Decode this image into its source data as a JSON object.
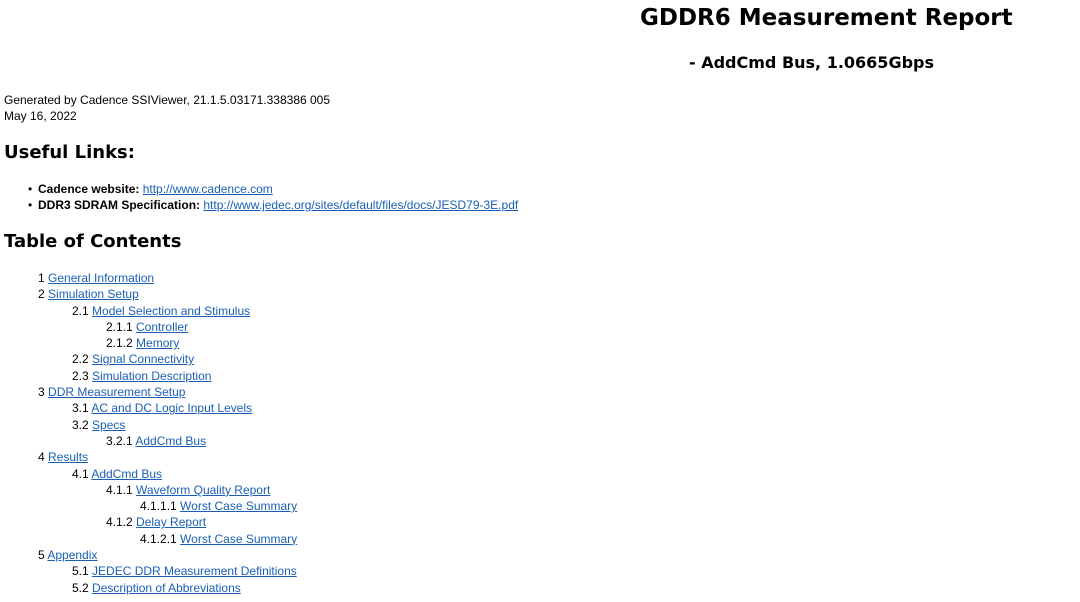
{
  "header": {
    "title": "GDDR6 Measurement Report",
    "subtitle": "- AddCmd Bus, 1.0665Gbps"
  },
  "meta": {
    "generated_by": "Generated by Cadence SSIViewer, 21.1.5.03171.338386 005",
    "date": "May 16, 2022"
  },
  "useful_links": {
    "heading": "Useful Links:",
    "items": [
      {
        "label": "Cadence website:",
        "url_text": "http://www.cadence.com"
      },
      {
        "label": "DDR3 SDRAM Specification:",
        "url_text": "http://www.jedec.org/sites/default/files/docs/JESD79-3E.pdf"
      }
    ]
  },
  "toc": {
    "heading": "Table of Contents",
    "items": [
      {
        "num": "1",
        "text": "General Information",
        "level": 1
      },
      {
        "num": "2",
        "text": "Simulation Setup",
        "level": 1
      },
      {
        "num": "2.1",
        "text": "Model Selection and Stimulus",
        "level": 2
      },
      {
        "num": "2.1.1",
        "text": "Controller",
        "level": 3
      },
      {
        "num": "2.1.2",
        "text": "Memory",
        "level": 3
      },
      {
        "num": "2.2",
        "text": "Signal Connectivity",
        "level": 2
      },
      {
        "num": "2.3",
        "text": "Simulation Description",
        "level": 2
      },
      {
        "num": "3",
        "text": "DDR Measurement Setup",
        "level": 1
      },
      {
        "num": "3.1",
        "text": "AC and DC Logic Input Levels",
        "level": 2
      },
      {
        "num": "3.2",
        "text": "Specs",
        "level": 2
      },
      {
        "num": "3.2.1",
        "text": "AddCmd Bus",
        "level": 3
      },
      {
        "num": "4",
        "text": "Results",
        "level": 1
      },
      {
        "num": "4.1",
        "text": "AddCmd Bus",
        "level": 2
      },
      {
        "num": "4.1.1",
        "text": "Waveform Quality Report",
        "level": 3
      },
      {
        "num": "4.1.1.1",
        "text": "Worst Case Summary",
        "level": 4
      },
      {
        "num": "4.1.2",
        "text": "Delay Report",
        "level": 3
      },
      {
        "num": "4.1.2.1",
        "text": "Worst Case Summary",
        "level": 4
      },
      {
        "num": "5",
        "text": "Appendix",
        "level": 1
      },
      {
        "num": "5.1",
        "text": "JEDEC DDR Measurement Definitions",
        "level": 2
      },
      {
        "num": "5.2",
        "text": "Description of Abbreviations",
        "level": 2
      }
    ]
  },
  "colors": {
    "link": "#1a5fb4",
    "text": "#000000",
    "background": "#ffffff"
  }
}
